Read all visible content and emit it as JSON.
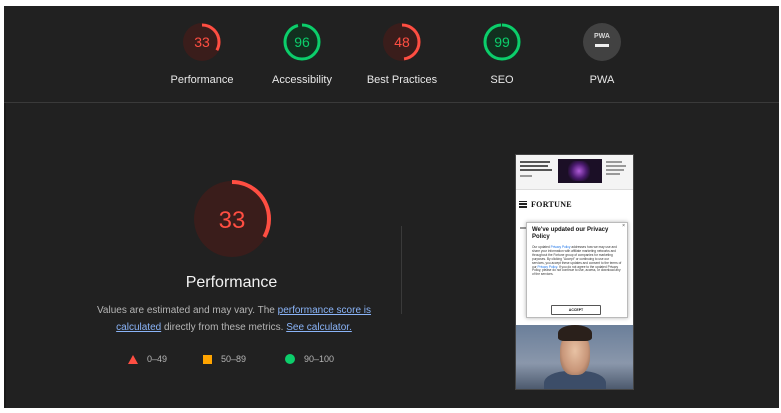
{
  "colors": {
    "background": "#212121",
    "fail": "#ff4e42",
    "average": "#ffa400",
    "pass": "#0cce6b",
    "link": "#8ab4f8",
    "pwa_badge": "#424242"
  },
  "gauges": [
    {
      "label": "Performance",
      "score": 33,
      "status": "fail"
    },
    {
      "label": "Accessibility",
      "score": 96,
      "status": "pass"
    },
    {
      "label": "Best Practices",
      "score": 48,
      "status": "fail"
    },
    {
      "label": "SEO",
      "score": 99,
      "status": "pass"
    },
    {
      "label": "PWA",
      "icon": "pwa-badge-icon",
      "badge_text": "PWA"
    }
  ],
  "performance": {
    "score": 33,
    "title": "Performance",
    "desc_before": "Values are estimated and may vary. The ",
    "desc_link1": "performance score is calculated",
    "desc_middle": " directly from these metrics. ",
    "desc_link2": "See calculator."
  },
  "legend": [
    {
      "icon": "red-triangle-icon",
      "range": "0–49"
    },
    {
      "icon": "orange-square-icon",
      "range": "50–89"
    },
    {
      "icon": "green-circle-icon",
      "range": "90–100"
    }
  ],
  "screenshot": {
    "logo": "FORTUNE",
    "modal_title": "We've updated our Privacy Policy",
    "modal_body_1": "Our updated ",
    "modal_link_1": "Privacy Policy",
    "modal_body_2": " addresses how we may use and share your information with affiliate marketing networks and throughout the Fortune group of companies for marketing purposes. By clicking \"Accept\" or continuing to use our services, you accept these updates and consent to the terms of our ",
    "modal_link_2": "Privacy Policy",
    "modal_body_3": ". If you do not agree to the updated Privacy Policy, please do not continue to use, access, or download any of the services.",
    "accept_label": "ACCEPT",
    "close_symbol": "×"
  }
}
